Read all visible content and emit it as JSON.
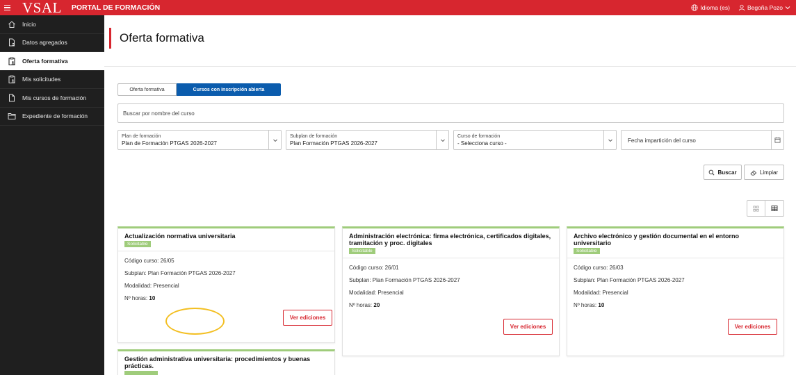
{
  "topbar": {
    "logo": "VSAL",
    "portal_title": "PORTAL DE FORMACIÓN",
    "language": "Idioma (es)",
    "user": "Begoña Pozo",
    "brand_color": "#d7262f"
  },
  "sidebar": {
    "items": [
      {
        "label": "Inicio",
        "icon": "home-icon",
        "active": false
      },
      {
        "label": "Datos agregados",
        "icon": "file-user-icon",
        "active": false
      },
      {
        "label": "Oferta formativa",
        "icon": "clipboard-user-icon",
        "active": true
      },
      {
        "label": "Mis solicitudes",
        "icon": "clipboard-user-icon",
        "active": false
      },
      {
        "label": "Mis cursos de formación",
        "icon": "file-icon",
        "active": false
      },
      {
        "label": "Expediente de formación",
        "icon": "folder-icon",
        "active": false
      }
    ]
  },
  "main": {
    "title": "Oferta formativa",
    "tabs": [
      {
        "label": "Oferta formativa",
        "active": false
      },
      {
        "label": "Cursos con inscripción abierta",
        "active": true
      }
    ],
    "search_placeholder": "Buscar por nombre del curso",
    "filters": {
      "plan": {
        "label": "Plan de formación",
        "value": "Plan de Formación PTGAS 2026-2027"
      },
      "subplan": {
        "label": "Subplan de formación",
        "value": "Plan Formación PTGAS 2026-2027"
      },
      "curso": {
        "label": "Curso de formación",
        "value": "- Selecciona curso -"
      },
      "fecha_placeholder": "Fecha impartición del curso"
    },
    "buttons": {
      "search": "Buscar",
      "clear": "Limpiar"
    }
  },
  "cards": [
    {
      "title": "Actualización normativa universitaria",
      "badge": "Solicitable",
      "codigo": "Código curso: 26/05",
      "subplan": "Subplan: Plan Formación PTGAS 2026-2027",
      "modalidad": "Modalidad: Presencial",
      "horas_label": "Nº horas: ",
      "horas": "10",
      "button": "Ver ediciones"
    },
    {
      "title": "Administración electrónica: firma electrónica, certificados digitales, tramitación y proc. digitales",
      "badge": "Solicitable",
      "codigo": "Código curso: 26/01",
      "subplan": "Subplan: Plan Formación PTGAS 2026-2027",
      "modalidad": "Modalidad: Presencial",
      "horas_label": "Nº horas: ",
      "horas": "20",
      "button": "Ver ediciones"
    },
    {
      "title": "Archivo electrónico y gestión documental en el entorno universitario",
      "badge": "Solicitable",
      "codigo": "Código curso: 26/03",
      "subplan": "Subplan: Plan Formación PTGAS 2026-2027",
      "modalidad": "Modalidad: Presencial",
      "horas_label": "Nº horas: ",
      "horas": "10",
      "button": "Ver ediciones"
    },
    {
      "title": "Gestión administrativa universitaria: procedimientos y buenas prácticas."
    }
  ]
}
